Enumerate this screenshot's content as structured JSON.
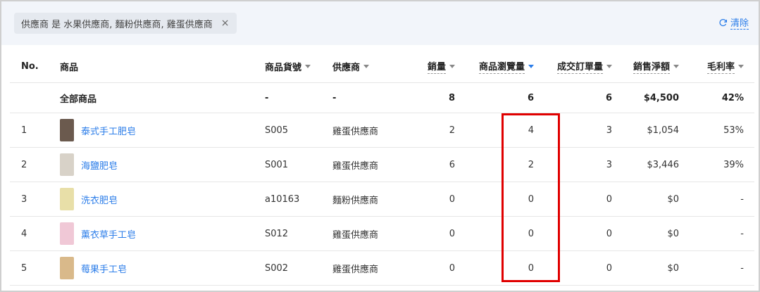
{
  "filter": {
    "chip_text": "供應商 是 水果供應商, 麵粉供應商, 雞蛋供應商",
    "chip_close": "×",
    "clear_label": "清除"
  },
  "columns": {
    "no": "No.",
    "product": "商品",
    "sku": "商品貨號",
    "supplier": "供應商",
    "qty": "銷量",
    "views": "商品瀏覽量",
    "orders": "成交訂單量",
    "net_sales": "銷售淨額",
    "margin": "毛利率"
  },
  "summary": {
    "product": "全部商品",
    "sku": "-",
    "supplier": "-",
    "qty": "8",
    "views": "6",
    "orders": "6",
    "net_sales": "$4,500",
    "margin": "42%"
  },
  "rows": [
    {
      "no": "1",
      "name": "泰式手工肥皂",
      "sku": "S005",
      "supplier": "雞蛋供應商",
      "qty": "2",
      "views": "4",
      "orders": "3",
      "net_sales": "$1,054",
      "margin": "53%",
      "thumb_color": "#6b5a4e"
    },
    {
      "no": "2",
      "name": "海鹽肥皂",
      "sku": "S001",
      "supplier": "雞蛋供應商",
      "qty": "6",
      "views": "2",
      "orders": "3",
      "net_sales": "$3,446",
      "margin": "39%",
      "thumb_color": "#d8d2c8"
    },
    {
      "no": "3",
      "name": "洗衣肥皂",
      "sku": "a10163",
      "supplier": "麵粉供應商",
      "qty": "0",
      "views": "0",
      "orders": "0",
      "net_sales": "$0",
      "margin": "-",
      "thumb_color": "#e8dfa8"
    },
    {
      "no": "4",
      "name": "薰衣草手工皂",
      "sku": "S012",
      "supplier": "雞蛋供應商",
      "qty": "0",
      "views": "0",
      "orders": "0",
      "net_sales": "$0",
      "margin": "-",
      "thumb_color": "#f0c8d6"
    },
    {
      "no": "5",
      "name": "莓果手工皂",
      "sku": "S002",
      "supplier": "雞蛋供應商",
      "qty": "0",
      "views": "0",
      "orders": "0",
      "net_sales": "$0",
      "margin": "-",
      "thumb_color": "#d9b98a"
    }
  ],
  "colors": {
    "accent": "#2b7de9",
    "highlight": "#e00000"
  }
}
